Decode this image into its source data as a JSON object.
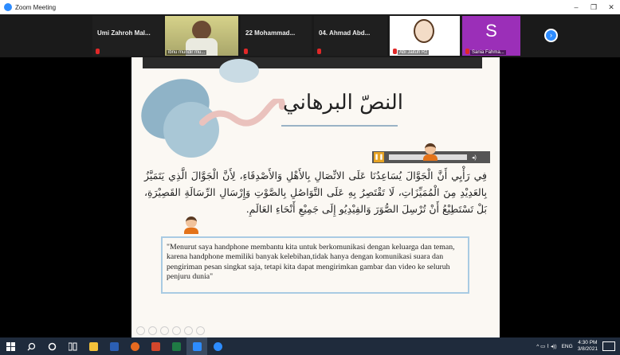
{
  "window": {
    "title": "Zoom Meeting",
    "min": "–",
    "max": "❐",
    "close": "✕"
  },
  "participants": [
    {
      "name": "Umi Zahroh Mal...",
      "caption": ""
    },
    {
      "name": "",
      "caption": "ibnu mundir mu..."
    },
    {
      "name": "22 Mohammad...",
      "caption": ""
    },
    {
      "name": "04. Ahmad Abd...",
      "caption": ""
    },
    {
      "name": "",
      "caption": "Abi Jaituh Rz"
    },
    {
      "name": "",
      "caption": "Sania Fahma...",
      "letter": "S"
    }
  ],
  "next_icon": "›",
  "slide": {
    "title": "النصّ البرهاني",
    "arabic_text": "فِي رَأْيِي أَنَّ الْجَوَّالَ يُسَاعِدُنَا عَلَى الاتِّصَالِ بِالأَهْلِ وَالأَصْدِقَاءِ، لِأَنَّ الْجَوَّالَ الَّذِي يَتَمَيَّزُ بِالعَدِيْدِ مِنَ الْمُمَيِّزَاتِ، لَا تَقْتَصِرُ بِهِ عَلَى التَّوَاصُلِ بِالصَّوْتِ وَإِرْسَالِ الرِّسَالَةِ القَصِيْرَةِ، بَلْ تَسْتَطِيْعُ أَنْ تُرْسِلَ الصُّوَرَ وَالفِيْدِيُو إِلَى جَمِيْعِ أَنْحَاءِ العَالَمِ.",
    "quote": "\"Menurut saya handphone membantu kita untuk berkomunikasi dengan keluarga dan teman, karena handphone memiliki banyak kelebihan,tidak hanya dengan komunikasi suara dan pengiriman pesan singkat saja, tetapi kita dapat mengirimkan gambar dan video ke seluruh penjuru dunia\"",
    "player": {
      "pause_icon": "❚❚",
      "volume_icon": "◂)"
    }
  },
  "taskbar": {
    "icons": [
      "windows-icon",
      "search-icon",
      "cortana-icon",
      "task-view-icon",
      "file-explorer-icon",
      "word-icon",
      "firefox-icon",
      "powerpoint-icon",
      "excel-icon",
      "zoom-icon",
      "zoom-meeting-icon"
    ],
    "tray_icons": "^  ▭  ⌇  ◂))",
    "lang": "ENG",
    "time": "4:30 PM",
    "date": "3/8/2021"
  },
  "colors": {
    "accent": "#2d8cff",
    "s_tile": "#9b2fb8",
    "taskbar": "#1f2b3c"
  }
}
